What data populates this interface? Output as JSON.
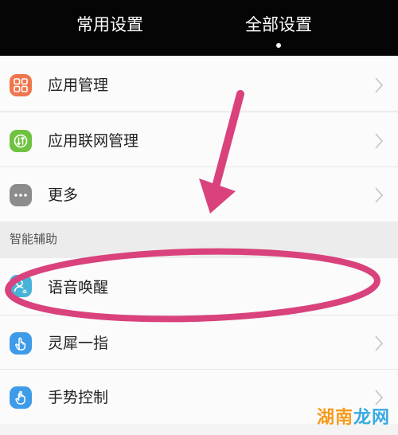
{
  "tabs": [
    {
      "label": "常用设置"
    },
    {
      "label": "全部设置",
      "active": true
    }
  ],
  "items": [
    {
      "label": "应用管理",
      "icon": "grid-icon",
      "color": "#f0764e"
    },
    {
      "label": "应用联网管理",
      "icon": "network-icon",
      "color": "#6fc23f"
    },
    {
      "label": "更多",
      "icon": "more-icon",
      "color": "#8c8c8c"
    }
  ],
  "section": {
    "title": "智能辅助"
  },
  "assist_items": [
    {
      "label": "语音唤醒",
      "icon": "voice-user-icon",
      "color": "#47b3d8"
    },
    {
      "label": "灵犀一指",
      "icon": "finger-icon",
      "color": "#3e9be8"
    },
    {
      "label": "手势控制",
      "icon": "hand-icon",
      "color": "#3e9be8"
    }
  ],
  "annotation": {
    "color": "#d9427c"
  },
  "watermark": {
    "part1": "湖南",
    "part2": "龙网"
  }
}
